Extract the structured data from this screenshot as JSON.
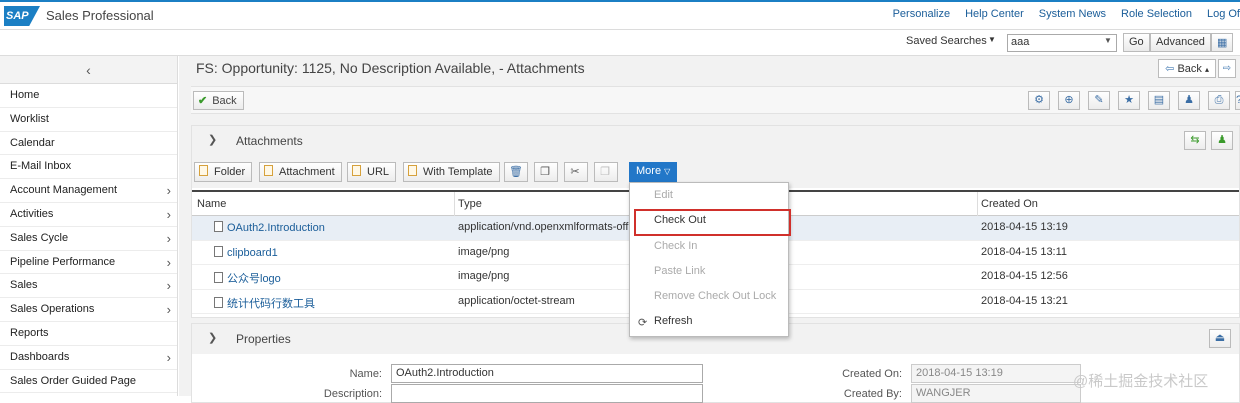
{
  "app": {
    "logo": "SAP",
    "title": "Sales Professional"
  },
  "top_links": [
    "Personalize",
    "Help Center",
    "System News",
    "Role Selection",
    "Log Of"
  ],
  "search": {
    "saved_label": "Saved Searches",
    "value": "aaa",
    "go_label": "Go",
    "advanced_label": "Advanced"
  },
  "sidebar": {
    "items": [
      {
        "label": "Home",
        "chevron": false
      },
      {
        "label": "Worklist",
        "chevron": false
      },
      {
        "label": "Calendar",
        "chevron": false
      },
      {
        "label": "E-Mail Inbox",
        "chevron": false
      },
      {
        "label": "Account Management",
        "chevron": true
      },
      {
        "label": "Activities",
        "chevron": true
      },
      {
        "label": "Sales Cycle",
        "chevron": true
      },
      {
        "label": "Pipeline Performance",
        "chevron": true
      },
      {
        "label": "Sales",
        "chevron": true
      },
      {
        "label": "Sales Operations",
        "chevron": true
      },
      {
        "label": "Reports",
        "chevron": false
      },
      {
        "label": "Dashboards",
        "chevron": true
      },
      {
        "label": "Sales Order Guided Page",
        "chevron": false
      }
    ]
  },
  "page": {
    "title": "FS: Opportunity: 1125, No Description Available, - Attachments",
    "back_label": "Back",
    "nav_back_label": "Back"
  },
  "attachments": {
    "title": "Attachments",
    "buttons": {
      "folder": "Folder",
      "attachment": "Attachment",
      "url": "URL",
      "template": "With Template",
      "more": "More"
    },
    "columns": [
      "Name",
      "Type",
      "Created On"
    ],
    "rows": [
      {
        "name": "OAuth2.Introduction",
        "type": "application/vnd.openxmlformats-office",
        "created": "2018-04-15 13:19"
      },
      {
        "name": "clipboard1",
        "type": "image/png",
        "created": "2018-04-15 13:11"
      },
      {
        "name": "公众号logo",
        "type": "image/png",
        "created": "2018-04-15 12:56"
      },
      {
        "name": "统计代码行数工具",
        "type": "application/octet-stream",
        "created": "2018-04-15 13:21"
      }
    ]
  },
  "more_menu": {
    "items": [
      {
        "label": "Edit",
        "enabled": false
      },
      {
        "label": "Check Out",
        "enabled": true
      },
      {
        "label": "Check In",
        "enabled": false
      },
      {
        "label": "Paste Link",
        "enabled": false
      },
      {
        "label": "Remove Check Out Lock",
        "enabled": false
      },
      {
        "label": "Refresh",
        "enabled": true
      }
    ]
  },
  "properties": {
    "title": "Properties",
    "name_label": "Name:",
    "name_value": "OAuth2.Introduction",
    "description_label": "Description:",
    "created_on_label": "Created On:",
    "created_on_value": "2018-04-15 13:19",
    "created_by_label": "Created By:",
    "created_by_value": "WANGJER"
  },
  "watermark": "@稀土掘金技术社区",
  "colors": {
    "accent": "#2277c8",
    "link": "#1a5d99",
    "highlight": "#d0302b"
  }
}
